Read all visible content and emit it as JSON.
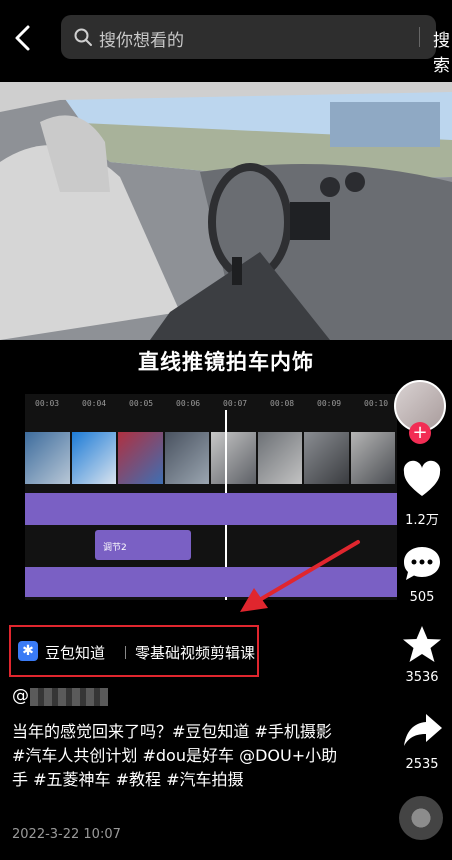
{
  "search": {
    "placeholder": "搜你想看的",
    "button": "搜索"
  },
  "video": {
    "caption": "直线推镜拍车内饰",
    "timeline_ticks": [
      "00:03",
      "00:04",
      "00:05",
      "00:06",
      "00:07",
      "00:08",
      "00:09",
      "00:10"
    ],
    "chip_label": "调节2"
  },
  "actions": {
    "likes": "1.2万",
    "comments": "505",
    "favorites": "3536",
    "shares": "2535"
  },
  "knowledge": {
    "label": "豆包知道",
    "title": "零基础视频剪辑课"
  },
  "author": "@",
  "description": "当年的感觉回来了吗？#豆包知道 #手机摄影 #汽车人共创计划 #dou是好车 @DOU+小助手 #五菱神车 #教程 #汽车拍摄",
  "date": "2022-3-22 10:07",
  "colors": {
    "accent_red": "#e0262e",
    "follow_pink": "#f22d54",
    "timeline_purple": "#7a60c4",
    "badge_blue": "#3a7bf5"
  }
}
